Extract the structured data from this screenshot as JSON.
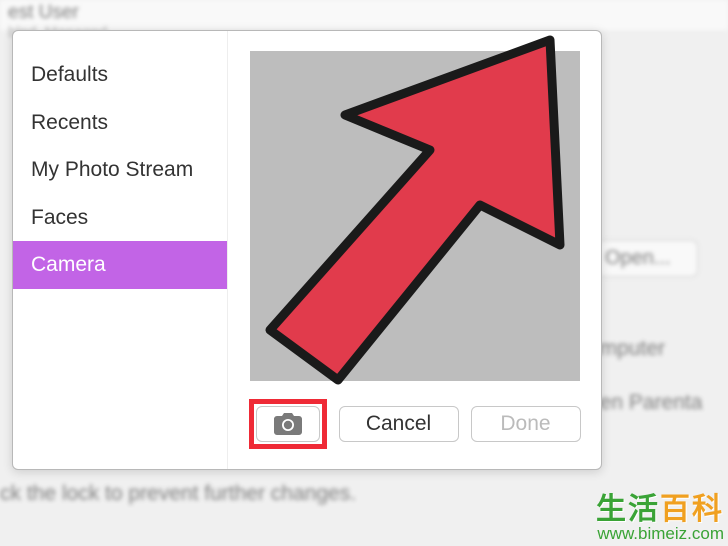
{
  "bg": {
    "user_title": "est User",
    "user_sub": "bled, Managed",
    "open_btn": "Open...",
    "txt1": "omputer",
    "txt2": "pen Parenta",
    "bottom": "ck the lock to prevent further changes."
  },
  "sidebar": {
    "items": [
      {
        "label": "Defaults",
        "selected": false
      },
      {
        "label": "Recents",
        "selected": false
      },
      {
        "label": "My Photo Stream",
        "selected": false
      },
      {
        "label": "Faces",
        "selected": false
      },
      {
        "label": "Camera",
        "selected": true
      }
    ]
  },
  "buttons": {
    "cancel": "Cancel",
    "done": "Done"
  },
  "watermark": {
    "cn1": "生活",
    "cn2": "百科",
    "url": "www.bimeiz.com"
  }
}
